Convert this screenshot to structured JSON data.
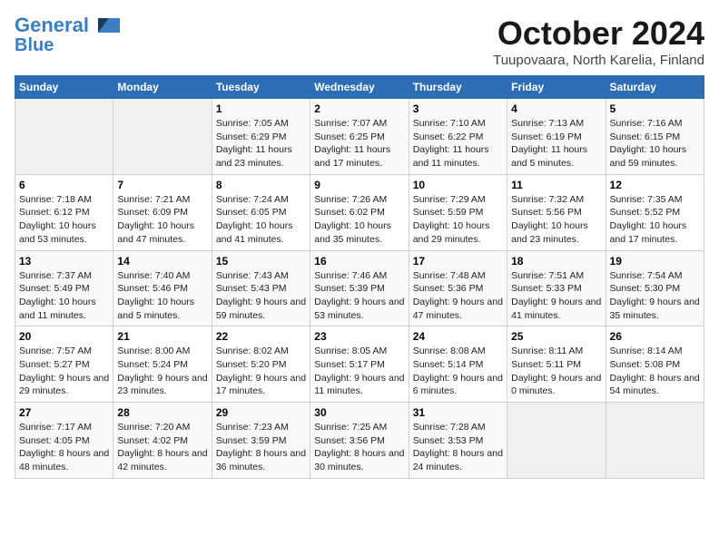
{
  "header": {
    "logo_line1": "General",
    "logo_line2": "Blue",
    "month_title": "October 2024",
    "location": "Tuupovaara, North Karelia, Finland"
  },
  "days_of_week": [
    "Sunday",
    "Monday",
    "Tuesday",
    "Wednesday",
    "Thursday",
    "Friday",
    "Saturday"
  ],
  "weeks": [
    [
      {
        "day": "",
        "info": ""
      },
      {
        "day": "",
        "info": ""
      },
      {
        "day": "1",
        "info": "Sunrise: 7:05 AM\nSunset: 6:29 PM\nDaylight: 11 hours and 23 minutes."
      },
      {
        "day": "2",
        "info": "Sunrise: 7:07 AM\nSunset: 6:25 PM\nDaylight: 11 hours and 17 minutes."
      },
      {
        "day": "3",
        "info": "Sunrise: 7:10 AM\nSunset: 6:22 PM\nDaylight: 11 hours and 11 minutes."
      },
      {
        "day": "4",
        "info": "Sunrise: 7:13 AM\nSunset: 6:19 PM\nDaylight: 11 hours and 5 minutes."
      },
      {
        "day": "5",
        "info": "Sunrise: 7:16 AM\nSunset: 6:15 PM\nDaylight: 10 hours and 59 minutes."
      }
    ],
    [
      {
        "day": "6",
        "info": "Sunrise: 7:18 AM\nSunset: 6:12 PM\nDaylight: 10 hours and 53 minutes."
      },
      {
        "day": "7",
        "info": "Sunrise: 7:21 AM\nSunset: 6:09 PM\nDaylight: 10 hours and 47 minutes."
      },
      {
        "day": "8",
        "info": "Sunrise: 7:24 AM\nSunset: 6:05 PM\nDaylight: 10 hours and 41 minutes."
      },
      {
        "day": "9",
        "info": "Sunrise: 7:26 AM\nSunset: 6:02 PM\nDaylight: 10 hours and 35 minutes."
      },
      {
        "day": "10",
        "info": "Sunrise: 7:29 AM\nSunset: 5:59 PM\nDaylight: 10 hours and 29 minutes."
      },
      {
        "day": "11",
        "info": "Sunrise: 7:32 AM\nSunset: 5:56 PM\nDaylight: 10 hours and 23 minutes."
      },
      {
        "day": "12",
        "info": "Sunrise: 7:35 AM\nSunset: 5:52 PM\nDaylight: 10 hours and 17 minutes."
      }
    ],
    [
      {
        "day": "13",
        "info": "Sunrise: 7:37 AM\nSunset: 5:49 PM\nDaylight: 10 hours and 11 minutes."
      },
      {
        "day": "14",
        "info": "Sunrise: 7:40 AM\nSunset: 5:46 PM\nDaylight: 10 hours and 5 minutes."
      },
      {
        "day": "15",
        "info": "Sunrise: 7:43 AM\nSunset: 5:43 PM\nDaylight: 9 hours and 59 minutes."
      },
      {
        "day": "16",
        "info": "Sunrise: 7:46 AM\nSunset: 5:39 PM\nDaylight: 9 hours and 53 minutes."
      },
      {
        "day": "17",
        "info": "Sunrise: 7:48 AM\nSunset: 5:36 PM\nDaylight: 9 hours and 47 minutes."
      },
      {
        "day": "18",
        "info": "Sunrise: 7:51 AM\nSunset: 5:33 PM\nDaylight: 9 hours and 41 minutes."
      },
      {
        "day": "19",
        "info": "Sunrise: 7:54 AM\nSunset: 5:30 PM\nDaylight: 9 hours and 35 minutes."
      }
    ],
    [
      {
        "day": "20",
        "info": "Sunrise: 7:57 AM\nSunset: 5:27 PM\nDaylight: 9 hours and 29 minutes."
      },
      {
        "day": "21",
        "info": "Sunrise: 8:00 AM\nSunset: 5:24 PM\nDaylight: 9 hours and 23 minutes."
      },
      {
        "day": "22",
        "info": "Sunrise: 8:02 AM\nSunset: 5:20 PM\nDaylight: 9 hours and 17 minutes."
      },
      {
        "day": "23",
        "info": "Sunrise: 8:05 AM\nSunset: 5:17 PM\nDaylight: 9 hours and 11 minutes."
      },
      {
        "day": "24",
        "info": "Sunrise: 8:08 AM\nSunset: 5:14 PM\nDaylight: 9 hours and 6 minutes."
      },
      {
        "day": "25",
        "info": "Sunrise: 8:11 AM\nSunset: 5:11 PM\nDaylight: 9 hours and 0 minutes."
      },
      {
        "day": "26",
        "info": "Sunrise: 8:14 AM\nSunset: 5:08 PM\nDaylight: 8 hours and 54 minutes."
      }
    ],
    [
      {
        "day": "27",
        "info": "Sunrise: 7:17 AM\nSunset: 4:05 PM\nDaylight: 8 hours and 48 minutes."
      },
      {
        "day": "28",
        "info": "Sunrise: 7:20 AM\nSunset: 4:02 PM\nDaylight: 8 hours and 42 minutes."
      },
      {
        "day": "29",
        "info": "Sunrise: 7:23 AM\nSunset: 3:59 PM\nDaylight: 8 hours and 36 minutes."
      },
      {
        "day": "30",
        "info": "Sunrise: 7:25 AM\nSunset: 3:56 PM\nDaylight: 8 hours and 30 minutes."
      },
      {
        "day": "31",
        "info": "Sunrise: 7:28 AM\nSunset: 3:53 PM\nDaylight: 8 hours and 24 minutes."
      },
      {
        "day": "",
        "info": ""
      },
      {
        "day": "",
        "info": ""
      }
    ]
  ]
}
